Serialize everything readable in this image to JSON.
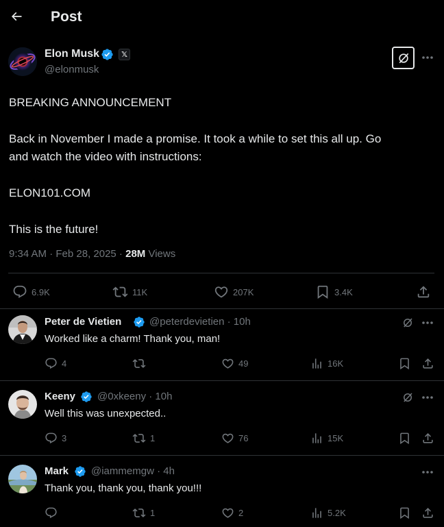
{
  "header": {
    "title": "Post"
  },
  "post": {
    "author_name": "Elon Musk",
    "author_handle": "@elonmusk",
    "affiliate_badge": "𝕏",
    "lines": [
      "BREAKING ANNOUNCEMENT",
      "Back in November I made a promise. It took a while to set this all up. Go",
      "and watch the video with instructions:",
      "ELON101.COM",
      "This is the future!"
    ],
    "timestamp": "9:34 AM · Feb 28, 2025 · ",
    "views_count": "28M",
    "views_label": " Views",
    "stats": {
      "replies": "6.9K",
      "reposts": "11K",
      "likes": "207K",
      "bookmarks": "3.4K"
    }
  },
  "replies": [
    {
      "name": "Peter de Vietien",
      "handle": "@peterdevietien · 10h",
      "text": "Worked like a charm! Thank you, man!",
      "replies": "4",
      "reposts": "",
      "likes": "49",
      "views": "16K"
    },
    {
      "name": "Keeny",
      "handle": "@0xkeeny · 10h",
      "text": "Well this was unexpected..",
      "replies": "3",
      "reposts": "1",
      "likes": "76",
      "views": "15K"
    },
    {
      "name": "Mark",
      "handle": "@iammemgw · 4h",
      "text": "Thank you, thank you, thank you!!!",
      "replies": "",
      "reposts": "1",
      "likes": "2",
      "views": "5.2K"
    }
  ],
  "colors": {
    "background": "#000000",
    "text": "#e7e9ea",
    "muted": "#71767b",
    "border": "#2f3336",
    "verified": "#1d9bf0"
  }
}
